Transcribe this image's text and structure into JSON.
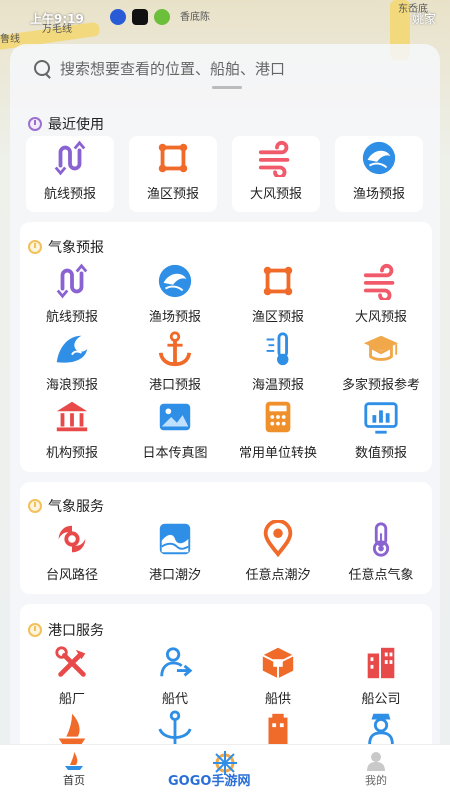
{
  "status_bar": {
    "time": "上午9:19",
    "right_text": "姚家"
  },
  "map": {
    "labels": [
      "万毛线",
      "香底陈",
      "鲁线",
      "东岙底"
    ]
  },
  "search": {
    "placeholder": "搜索想要查看的位置、船舶、港口"
  },
  "recent": {
    "title": "最近使用",
    "items": [
      {
        "label": "航线预报",
        "icon": "route-icon"
      },
      {
        "label": "渔区预报",
        "icon": "fishing-zone-icon"
      },
      {
        "label": "大风预报",
        "icon": "wind-icon"
      },
      {
        "label": "渔场预报",
        "icon": "fish-icon"
      }
    ]
  },
  "weather_forecast": {
    "title": "气象预报",
    "items": [
      {
        "label": "航线预报",
        "icon": "route-icon"
      },
      {
        "label": "渔场预报",
        "icon": "fish-icon"
      },
      {
        "label": "渔区预报",
        "icon": "fishing-zone-icon"
      },
      {
        "label": "大风预报",
        "icon": "wind-icon"
      },
      {
        "label": "海浪预报",
        "icon": "wave-icon"
      },
      {
        "label": "港口预报",
        "icon": "anchor-icon"
      },
      {
        "label": "海温预报",
        "icon": "thermometer-icon"
      },
      {
        "label": "多家预报参考",
        "icon": "graduation-cap-icon"
      },
      {
        "label": "机构预报",
        "icon": "institution-icon"
      },
      {
        "label": "日本传真图",
        "icon": "image-icon"
      },
      {
        "label": "常用单位转换",
        "icon": "calculator-icon"
      },
      {
        "label": "数值预报",
        "icon": "monitor-chart-icon"
      }
    ]
  },
  "weather_service": {
    "title": "气象服务",
    "items": [
      {
        "label": "台风路径",
        "icon": "typhoon-icon"
      },
      {
        "label": "港口潮汐",
        "icon": "tide-icon"
      },
      {
        "label": "任意点潮汐",
        "icon": "location-pin-icon"
      },
      {
        "label": "任意点气象",
        "icon": "thermometer-icon"
      }
    ]
  },
  "port_service": {
    "title": "港口服务",
    "items": [
      {
        "label": "船厂",
        "icon": "tools-icon"
      },
      {
        "label": "船代",
        "icon": "agent-icon"
      },
      {
        "label": "船供",
        "icon": "supply-box-icon"
      },
      {
        "label": "船公司",
        "icon": "company-building-icon"
      }
    ]
  },
  "tabbar": {
    "home": "首页",
    "mine": "我的"
  },
  "logo_text": "GOGO手游网",
  "colors": {
    "purple": "#8a63d2",
    "blue": "#2f8fe6",
    "orange": "#f06a2a",
    "red": "#e84a4a",
    "pink": "#f05a6a",
    "amber": "#f0902a"
  }
}
